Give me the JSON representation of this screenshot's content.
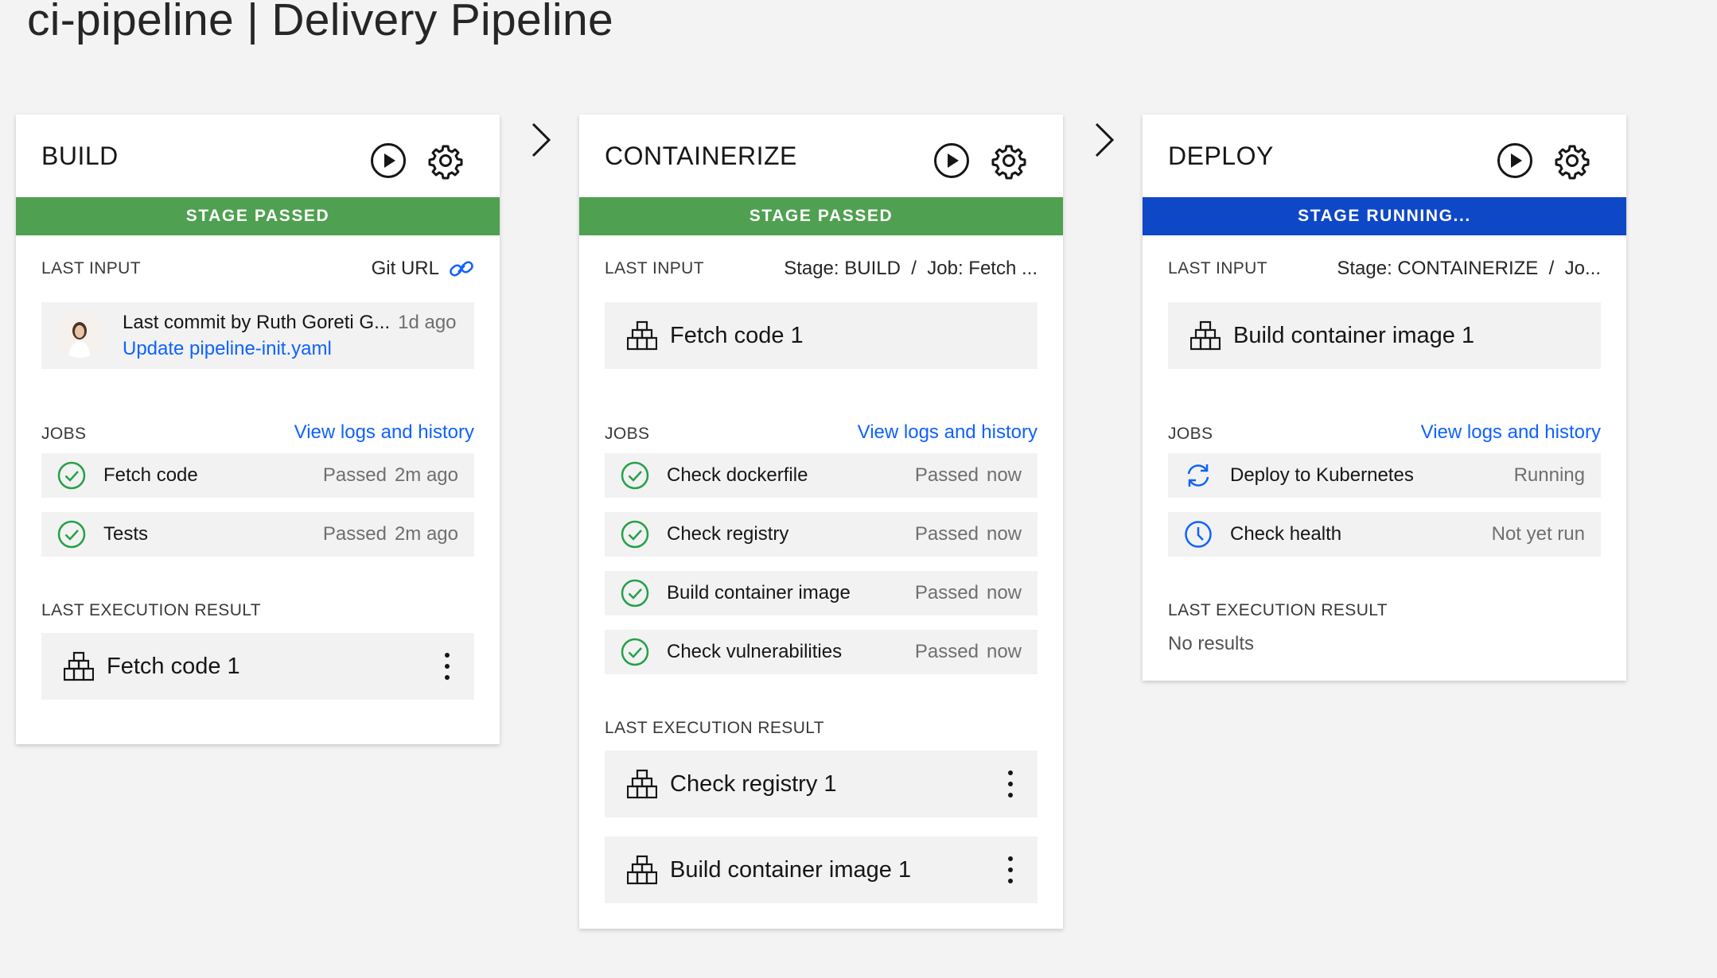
{
  "page": {
    "title": "ci-pipeline | Delivery Pipeline"
  },
  "colors": {
    "passed": "#4fa050",
    "running": "#0f48c7",
    "link": "#0f62fe",
    "success_icon": "#24a148"
  },
  "stages": [
    {
      "name": "BUILD",
      "status_label": "STAGE PASSED",
      "status_color": "#4fa050",
      "last_input_label": "LAST INPUT",
      "last_input_source": "Git URL",
      "commit": {
        "text": "Last commit by Ruth Goreti G...",
        "ago": "1d ago",
        "message": "Update pipeline-init.yaml"
      },
      "jobs_label": "JOBS",
      "view_logs": "View logs and history",
      "jobs": [
        {
          "name": "Fetch code",
          "status": "Passed",
          "time": "2m ago",
          "icon": "check-circle-icon"
        },
        {
          "name": "Tests",
          "status": "Passed",
          "time": "2m ago",
          "icon": "check-circle-icon"
        }
      ],
      "result_label": "LAST EXECUTION RESULT",
      "results": [
        "Fetch code 1"
      ]
    },
    {
      "name": "CONTAINERIZE",
      "status_label": "STAGE PASSED",
      "status_color": "#4fa050",
      "last_input_label": "LAST INPUT",
      "last_input_source": "Stage: BUILD  /  Job: Fetch ...",
      "input_tile": "Fetch code 1",
      "jobs_label": "JOBS",
      "view_logs": "View logs and history",
      "jobs": [
        {
          "name": "Check dockerfile",
          "status": "Passed",
          "time": "now",
          "icon": "check-circle-icon"
        },
        {
          "name": "Check registry",
          "status": "Passed",
          "time": "now",
          "icon": "check-circle-icon"
        },
        {
          "name": "Build container image",
          "status": "Passed",
          "time": "now",
          "icon": "check-circle-icon"
        },
        {
          "name": "Check vulnerabilities",
          "status": "Passed",
          "time": "now",
          "icon": "check-circle-icon"
        }
      ],
      "result_label": "LAST EXECUTION RESULT",
      "results": [
        "Check registry 1",
        "Build container image 1"
      ]
    },
    {
      "name": "DEPLOY",
      "status_label": "STAGE RUNNING...",
      "status_color": "#0f48c7",
      "last_input_label": "LAST INPUT",
      "last_input_source": "Stage: CONTAINERIZE  /  Jo...",
      "input_tile": "Build container image 1",
      "jobs_label": "JOBS",
      "view_logs": "View logs and history",
      "jobs": [
        {
          "name": "Deploy to Kubernetes",
          "status": "Running",
          "time": "",
          "icon": "sync-icon"
        },
        {
          "name": "Check health",
          "status": "Not yet run",
          "time": "",
          "icon": "clock-icon"
        }
      ],
      "result_label": "LAST EXECUTION RESULT",
      "no_results": "No results"
    }
  ]
}
